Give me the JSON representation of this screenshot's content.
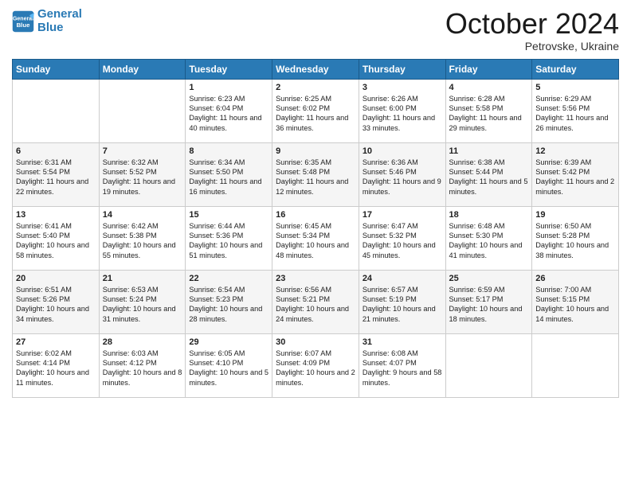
{
  "header": {
    "logo_line1": "General",
    "logo_line2": "Blue",
    "month_title": "October 2024",
    "subtitle": "Petrovske, Ukraine"
  },
  "weekdays": [
    "Sunday",
    "Monday",
    "Tuesday",
    "Wednesday",
    "Thursday",
    "Friday",
    "Saturday"
  ],
  "weeks": [
    [
      {
        "day": "",
        "sunrise": "",
        "sunset": "",
        "daylight": ""
      },
      {
        "day": "",
        "sunrise": "",
        "sunset": "",
        "daylight": ""
      },
      {
        "day": "1",
        "sunrise": "Sunrise: 6:23 AM",
        "sunset": "Sunset: 6:04 PM",
        "daylight": "Daylight: 11 hours and 40 minutes."
      },
      {
        "day": "2",
        "sunrise": "Sunrise: 6:25 AM",
        "sunset": "Sunset: 6:02 PM",
        "daylight": "Daylight: 11 hours and 36 minutes."
      },
      {
        "day": "3",
        "sunrise": "Sunrise: 6:26 AM",
        "sunset": "Sunset: 6:00 PM",
        "daylight": "Daylight: 11 hours and 33 minutes."
      },
      {
        "day": "4",
        "sunrise": "Sunrise: 6:28 AM",
        "sunset": "Sunset: 5:58 PM",
        "daylight": "Daylight: 11 hours and 29 minutes."
      },
      {
        "day": "5",
        "sunrise": "Sunrise: 6:29 AM",
        "sunset": "Sunset: 5:56 PM",
        "daylight": "Daylight: 11 hours and 26 minutes."
      }
    ],
    [
      {
        "day": "6",
        "sunrise": "Sunrise: 6:31 AM",
        "sunset": "Sunset: 5:54 PM",
        "daylight": "Daylight: 11 hours and 22 minutes."
      },
      {
        "day": "7",
        "sunrise": "Sunrise: 6:32 AM",
        "sunset": "Sunset: 5:52 PM",
        "daylight": "Daylight: 11 hours and 19 minutes."
      },
      {
        "day": "8",
        "sunrise": "Sunrise: 6:34 AM",
        "sunset": "Sunset: 5:50 PM",
        "daylight": "Daylight: 11 hours and 16 minutes."
      },
      {
        "day": "9",
        "sunrise": "Sunrise: 6:35 AM",
        "sunset": "Sunset: 5:48 PM",
        "daylight": "Daylight: 11 hours and 12 minutes."
      },
      {
        "day": "10",
        "sunrise": "Sunrise: 6:36 AM",
        "sunset": "Sunset: 5:46 PM",
        "daylight": "Daylight: 11 hours and 9 minutes."
      },
      {
        "day": "11",
        "sunrise": "Sunrise: 6:38 AM",
        "sunset": "Sunset: 5:44 PM",
        "daylight": "Daylight: 11 hours and 5 minutes."
      },
      {
        "day": "12",
        "sunrise": "Sunrise: 6:39 AM",
        "sunset": "Sunset: 5:42 PM",
        "daylight": "Daylight: 11 hours and 2 minutes."
      }
    ],
    [
      {
        "day": "13",
        "sunrise": "Sunrise: 6:41 AM",
        "sunset": "Sunset: 5:40 PM",
        "daylight": "Daylight: 10 hours and 58 minutes."
      },
      {
        "day": "14",
        "sunrise": "Sunrise: 6:42 AM",
        "sunset": "Sunset: 5:38 PM",
        "daylight": "Daylight: 10 hours and 55 minutes."
      },
      {
        "day": "15",
        "sunrise": "Sunrise: 6:44 AM",
        "sunset": "Sunset: 5:36 PM",
        "daylight": "Daylight: 10 hours and 51 minutes."
      },
      {
        "day": "16",
        "sunrise": "Sunrise: 6:45 AM",
        "sunset": "Sunset: 5:34 PM",
        "daylight": "Daylight: 10 hours and 48 minutes."
      },
      {
        "day": "17",
        "sunrise": "Sunrise: 6:47 AM",
        "sunset": "Sunset: 5:32 PM",
        "daylight": "Daylight: 10 hours and 45 minutes."
      },
      {
        "day": "18",
        "sunrise": "Sunrise: 6:48 AM",
        "sunset": "Sunset: 5:30 PM",
        "daylight": "Daylight: 10 hours and 41 minutes."
      },
      {
        "day": "19",
        "sunrise": "Sunrise: 6:50 AM",
        "sunset": "Sunset: 5:28 PM",
        "daylight": "Daylight: 10 hours and 38 minutes."
      }
    ],
    [
      {
        "day": "20",
        "sunrise": "Sunrise: 6:51 AM",
        "sunset": "Sunset: 5:26 PM",
        "daylight": "Daylight: 10 hours and 34 minutes."
      },
      {
        "day": "21",
        "sunrise": "Sunrise: 6:53 AM",
        "sunset": "Sunset: 5:24 PM",
        "daylight": "Daylight: 10 hours and 31 minutes."
      },
      {
        "day": "22",
        "sunrise": "Sunrise: 6:54 AM",
        "sunset": "Sunset: 5:23 PM",
        "daylight": "Daylight: 10 hours and 28 minutes."
      },
      {
        "day": "23",
        "sunrise": "Sunrise: 6:56 AM",
        "sunset": "Sunset: 5:21 PM",
        "daylight": "Daylight: 10 hours and 24 minutes."
      },
      {
        "day": "24",
        "sunrise": "Sunrise: 6:57 AM",
        "sunset": "Sunset: 5:19 PM",
        "daylight": "Daylight: 10 hours and 21 minutes."
      },
      {
        "day": "25",
        "sunrise": "Sunrise: 6:59 AM",
        "sunset": "Sunset: 5:17 PM",
        "daylight": "Daylight: 10 hours and 18 minutes."
      },
      {
        "day": "26",
        "sunrise": "Sunrise: 7:00 AM",
        "sunset": "Sunset: 5:15 PM",
        "daylight": "Daylight: 10 hours and 14 minutes."
      }
    ],
    [
      {
        "day": "27",
        "sunrise": "Sunrise: 6:02 AM",
        "sunset": "Sunset: 4:14 PM",
        "daylight": "Daylight: 10 hours and 11 minutes."
      },
      {
        "day": "28",
        "sunrise": "Sunrise: 6:03 AM",
        "sunset": "Sunset: 4:12 PM",
        "daylight": "Daylight: 10 hours and 8 minutes."
      },
      {
        "day": "29",
        "sunrise": "Sunrise: 6:05 AM",
        "sunset": "Sunset: 4:10 PM",
        "daylight": "Daylight: 10 hours and 5 minutes."
      },
      {
        "day": "30",
        "sunrise": "Sunrise: 6:07 AM",
        "sunset": "Sunset: 4:09 PM",
        "daylight": "Daylight: 10 hours and 2 minutes."
      },
      {
        "day": "31",
        "sunrise": "Sunrise: 6:08 AM",
        "sunset": "Sunset: 4:07 PM",
        "daylight": "Daylight: 9 hours and 58 minutes."
      },
      {
        "day": "",
        "sunrise": "",
        "sunset": "",
        "daylight": ""
      },
      {
        "day": "",
        "sunrise": "",
        "sunset": "",
        "daylight": ""
      }
    ]
  ]
}
